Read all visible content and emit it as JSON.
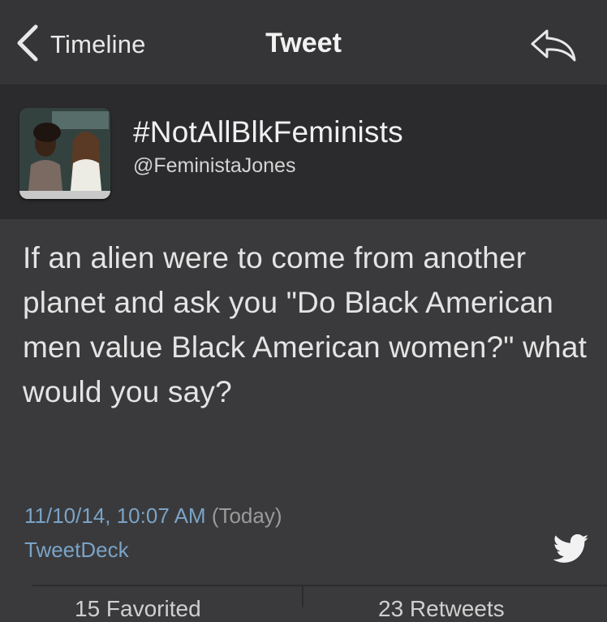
{
  "navbar": {
    "back_label": "Timeline",
    "title": "Tweet"
  },
  "profile": {
    "display_name": "#NotAllBlkFeminists",
    "handle": "@FeministaJones"
  },
  "tweet": {
    "text": "If an alien were to come from another planet and ask you \"Do Black American men value Black American women?\" what would you say?",
    "timestamp": "11/10/14, 10:07 AM",
    "relative": "(Today)",
    "source": "TweetDeck"
  },
  "stats": {
    "favorites": "15 Favorited",
    "retweets": "23 Retweets"
  },
  "icons": {
    "back": "chevron-left-icon",
    "share": "reply-arrow-icon",
    "bird": "twitter-bird-icon"
  },
  "colors": {
    "background": "#3a3a3c",
    "profile_bg": "#2b2b2d",
    "link": "#7aa3c7"
  }
}
